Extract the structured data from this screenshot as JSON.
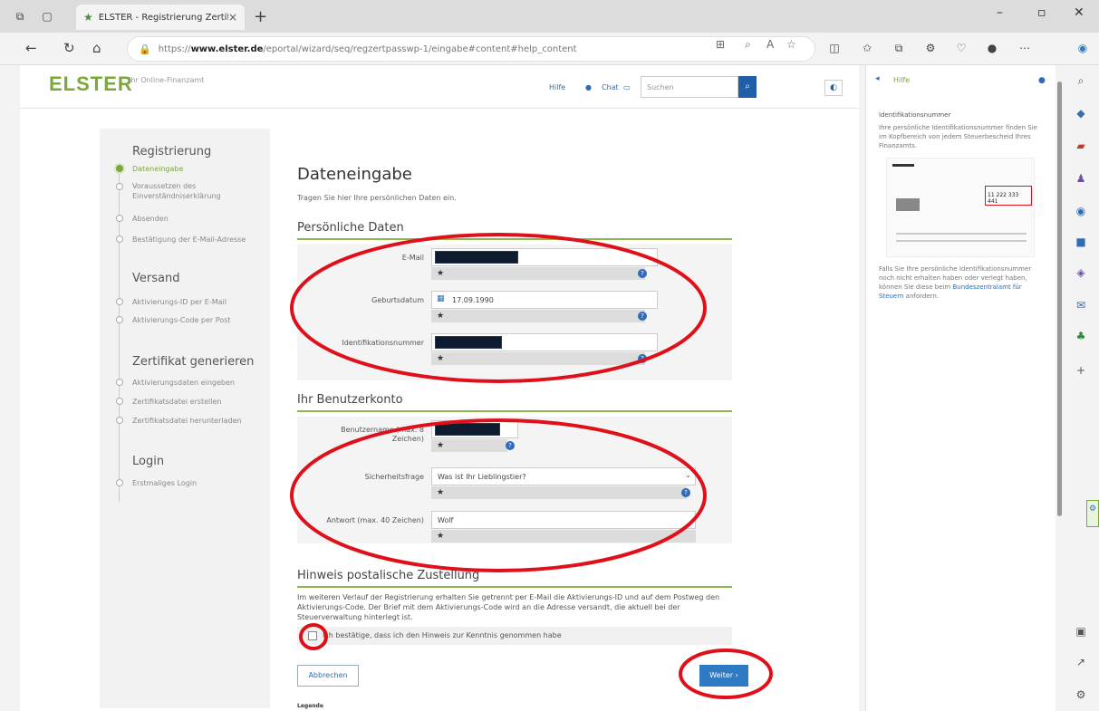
{
  "browser": {
    "tab_title": "ELSTER - Registrierung Zertifikat",
    "url_prefix": "https://",
    "url_domain": "www.elster.de",
    "url_path": "/eportal/wizard/seq/regzertpasswp-1/eingabe#content#help_content"
  },
  "header": {
    "logo": "ELSTER",
    "logo_sub": "Ihr Online-Finanzamt",
    "hilfe_label": "Hilfe",
    "chat_label": "Chat",
    "search_placeholder": "Suchen"
  },
  "leftnav": {
    "section_registrierung": "Registrierung",
    "reg_items": [
      "Dateneingabe",
      "Voraussetzen des Einverständniserklärung",
      "Absenden",
      "Bestätigung der E-Mail-Adresse"
    ],
    "section_versand": "Versand",
    "versand_items": [
      "Aktivierungs-ID per E-Mail",
      "Aktivierungs-Code per Post"
    ],
    "section_zertifikat": "Zertifikat generieren",
    "zert_items": [
      "Aktivierungsdaten eingeben",
      "Zertifikatsdatei erstellen",
      "Zertifikatsdatei herunterladen"
    ],
    "section_login": "Login",
    "login_items": [
      "Erstmaliges Login"
    ]
  },
  "main": {
    "title": "Dateneingabe",
    "intro": "Tragen Sie hier Ihre persönlichen Daten ein.",
    "sec_personal": "Persönliche Daten",
    "label_email": "E-Mail",
    "label_birth": "Geburtsdatum",
    "birth_value": "17.09.1990",
    "label_idnr": "Identifikationsnummer",
    "sec_account": "Ihr Benutzerkonto",
    "label_username": "Benutzername (max. 8 Zeichen)",
    "label_secq": "Sicherheitsfrage",
    "secq_value": "Was ist Ihr Lieblingstier?",
    "label_answer": "Antwort (max. 40 Zeichen)",
    "answer_value": "Wolf",
    "required_mark": "★",
    "sec_hinweis": "Hinweis postalische Zustellung",
    "hinweis_text": "Im weiteren Verlauf der Registrierung erhalten Sie getrennt per E-Mail die Aktivierungs-ID und auf dem Postweg den Aktivierungs-Code. Der Brief mit dem Aktivierungs-Code wird an die Adresse versandt, die aktuell bei der Steuerverwaltung hinterlegt ist.",
    "checkbox_label": "Ich bestätige, dass ich den Hinweis zur Kenntnis genommen habe",
    "btn_abort": "Abbrechen",
    "btn_next": "Weiter",
    "legend": "Legende"
  },
  "help": {
    "title": "Hilfe",
    "heading": "Identifikationsnummer",
    "text1": "Ihre persönliche Identifikationsnummer finden Sie im Kopfbereich von jedem Steuerbescheid Ihres Finanzamts.",
    "img_number": "11 222 333 441",
    "text2": "Falls Sie Ihre persönliche Identifikationsnummer noch nicht erhalten haben oder verlegt haben, können Sie diese beim",
    "link": "Bundeszentralamt für Steuern",
    "text3": "anfordern."
  },
  "colors": {
    "brand_green": "#7aa83a",
    "button_blue": "#2e7bc4",
    "annotation_red": "#e0101a"
  }
}
